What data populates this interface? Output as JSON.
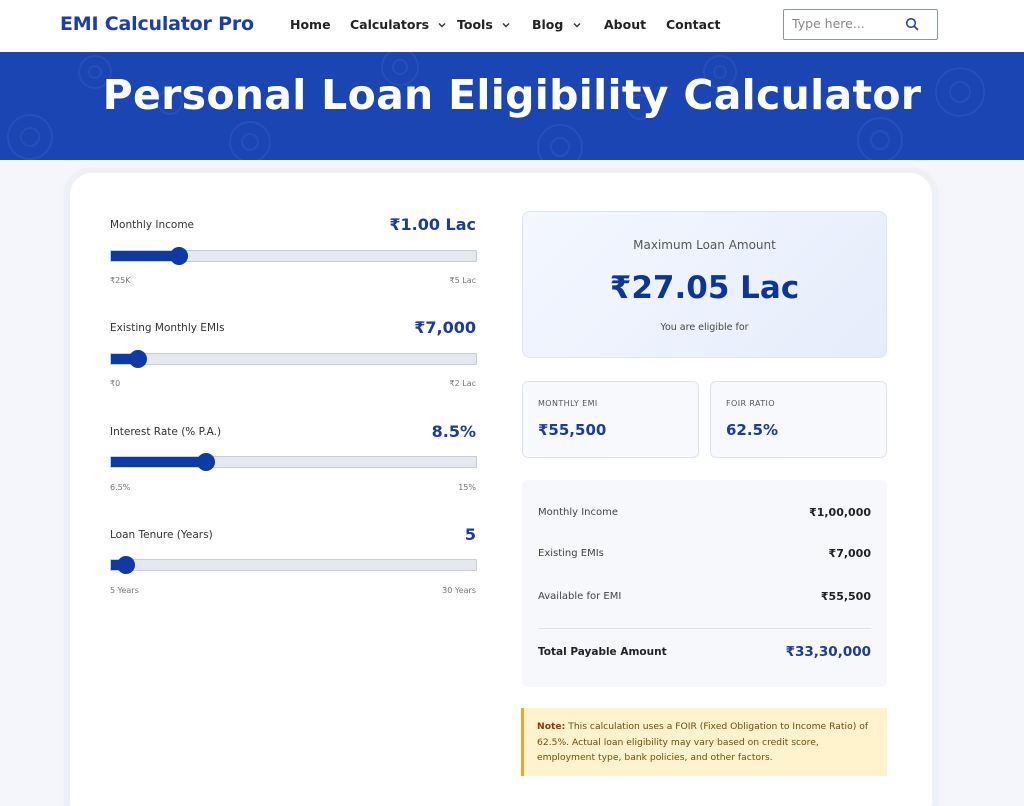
{
  "nav": {
    "brand": "EMI Calculator Pro",
    "items": [
      {
        "label": "Home",
        "caret": false
      },
      {
        "label": "Calculators",
        "caret": true
      },
      {
        "label": "Tools",
        "caret": true
      },
      {
        "label": "Blog",
        "caret": true
      },
      {
        "label": "About",
        "caret": false
      },
      {
        "label": "Contact",
        "caret": false
      }
    ],
    "search_placeholder": "Type here...",
    "search_icon": "search-icon"
  },
  "hero": {
    "title": "Personal Loan Eligibility Calculator"
  },
  "sliders": [
    {
      "label": "Monthly Income",
      "value": "₹1.00 Lac",
      "min_label": "₹25K",
      "max_label": "₹5 Lac",
      "fraction": 0.185
    },
    {
      "label": "Existing Monthly EMIs",
      "value": "₹7,000",
      "min_label": "₹0",
      "max_label": "₹2 Lac",
      "fraction": 0.075
    },
    {
      "label": "Interest Rate (% P.A.)",
      "value": "8.5%",
      "min_label": "6.5%",
      "max_label": "15%",
      "fraction": 0.26
    },
    {
      "label": "Loan Tenure (Years)",
      "value": "5",
      "min_label": "5 Years",
      "max_label": "30 Years",
      "fraction": 0.04
    }
  ],
  "result": {
    "title": "Maximum Loan Amount",
    "amount": "₹27.05 Lac",
    "subtitle": "You are eligible for"
  },
  "stats": [
    {
      "label": "MONTHLY EMI",
      "value": "₹55,500"
    },
    {
      "label": "FOIR RATIO",
      "value": "62.5%"
    }
  ],
  "breakdown": {
    "rows": [
      {
        "label": "Monthly Income",
        "value": "₹1,00,000"
      },
      {
        "label": "Existing EMIs",
        "value": "₹7,000"
      },
      {
        "label": "Available for EMI",
        "value": "₹55,500"
      }
    ],
    "total_label": "Total Payable Amount",
    "total_value": "₹33,30,000"
  },
  "note": {
    "prefix": "Note:",
    "text": " This calculation uses a FOIR (Fixed Obligation to Income Ratio) of 62.5%. Actual loan eligibility may vary based on credit score, employment type, bank policies, and other factors."
  },
  "colors": {
    "brand": "#1c3eaa",
    "hero_bg": "#1b45b3",
    "accent": "#0d3aa3",
    "note_bg": "#fff3cd",
    "note_border": "#f2a51e"
  }
}
